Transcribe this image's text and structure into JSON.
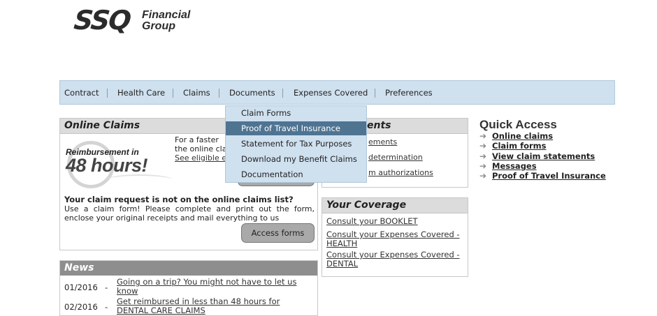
{
  "logo": {
    "mark": "SSQ",
    "line1": "Financial",
    "line2": "Group"
  },
  "nav": {
    "items": [
      "Contract",
      "Health Care",
      "Claims",
      "Documents",
      "Expenses Covered",
      "Preferences"
    ]
  },
  "dropdown": {
    "items": [
      "Claim Forms",
      "Proof of Travel Insurance",
      "Statement for Tax Purposes",
      "Download my Benefit Claims",
      "Documentation"
    ],
    "active_index": 1
  },
  "online_claims": {
    "title": "Online Claims",
    "graphic_line1": "Reimbursement in",
    "graphic_line2": "48 hours!",
    "intro_line1": "For a faster",
    "intro_line2": "the online cla",
    "intro_link": "See eligible e",
    "question": "Your claim request is not on the online claims list?",
    "body": "Use a claim form! Please complete and print out the form, enclose your original receipts and mail everything to us",
    "access_button": "Access forms"
  },
  "statements": {
    "title": "ents",
    "links": [
      "ements",
      "determination",
      "m authorizations"
    ]
  },
  "coverage": {
    "title": "Your Coverage",
    "links": [
      "Consult your BOOKLET",
      "Consult your Expenses Covered - HEALTH",
      "Consult your Expenses Covered - DENTAL"
    ]
  },
  "news": {
    "title": "News",
    "items": [
      {
        "date": "01/2016",
        "dash": "-",
        "text": "Going on a trip? You might not have to let us know"
      },
      {
        "date": "02/2016",
        "dash": "-",
        "text": "Get reimbursed in less than 48 hours for DENTAL CARE CLAIMS"
      }
    ]
  },
  "quick_access": {
    "title": "Quick Access",
    "arrow_icon": "right-arrow-icon",
    "links": [
      "Online claims",
      "Claim forms",
      "View claim statements",
      "Messages",
      "Proof of Travel Insurance"
    ]
  }
}
